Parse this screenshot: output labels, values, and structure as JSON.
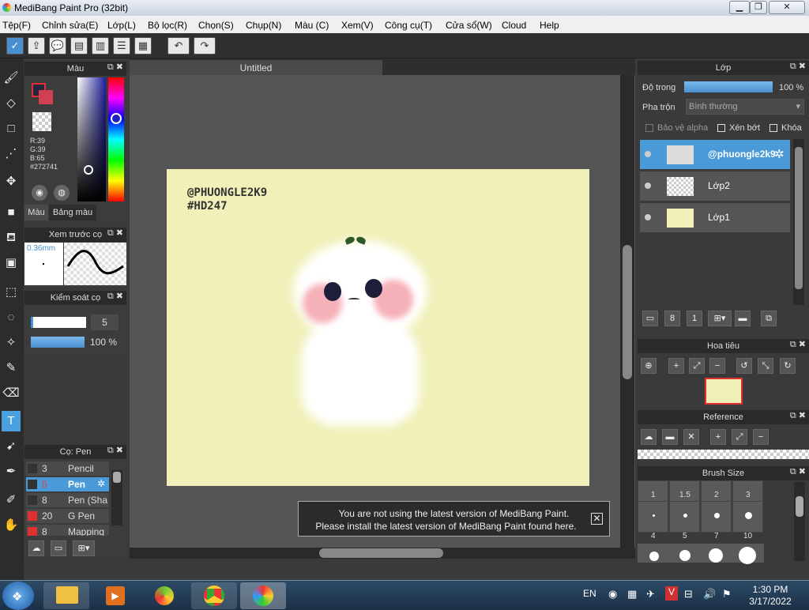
{
  "window": {
    "title": "MediBang Paint Pro (32bit)"
  },
  "menu": [
    "Tệp(F)",
    "Chỉnh sửa(E)",
    "Lớp(L)",
    "Bộ lọc(R)",
    "Chọn(S)",
    "Chụp(N)",
    "Màu (C)",
    "Xem(V)",
    "Công cụ(T)",
    "Cửa sổ(W)",
    "Cloud",
    "Help"
  ],
  "color_panel": {
    "title": "Màu",
    "r": "R:39",
    "g": "G:39",
    "b": "B:65",
    "hex": "#272741",
    "tab_color": "Màu",
    "tab_palette": "Bảng màu",
    "current_color": "#272741"
  },
  "brush_preview": {
    "title": "Xem trước cọ",
    "size": "0.36mm"
  },
  "brush_control": {
    "title": "Kiểm soát cọ",
    "size_value": "5",
    "opacity_value": "100 %"
  },
  "brush_list": {
    "title": "Cọ: Pen",
    "items": [
      {
        "size": "3",
        "name": "Pencil"
      },
      {
        "size": "5",
        "name": "Pen"
      },
      {
        "size": "8",
        "name": "Pen (Sha"
      },
      {
        "size": "20",
        "name": "G Pen"
      },
      {
        "size": "8",
        "name": "Mapping"
      }
    ]
  },
  "document": {
    "tab": "Untitled",
    "text_line1": "@PHUONGLE2K9",
    "text_line2": "#HD247"
  },
  "notification": {
    "line1": "You are not using the latest version of MediBang Paint.",
    "line2": "Please install the latest version of MediBang Paint found here."
  },
  "layer_panel": {
    "title": "Lớp",
    "opacity_label": "Độ trong",
    "opacity_value": "100 %",
    "blend_label": "Pha trộn",
    "blend_value": "Bình thường",
    "protect_alpha": "Bảo vệ alpha",
    "clipping": "Xén bớt",
    "lock": "Khóa",
    "layers": [
      "@phuongle2k9",
      "Lớp2",
      "Lớp1"
    ]
  },
  "navigator": {
    "title": "Hoa tiêu"
  },
  "reference": {
    "title": "Reference"
  },
  "brush_size": {
    "title": "Brush Size",
    "sizes": [
      "1",
      "1.5",
      "2",
      "3",
      "4",
      "5",
      "7",
      "10"
    ]
  },
  "taskbar": {
    "lang": "EN",
    "time": "1:30 PM",
    "date": "3/17/2022"
  }
}
